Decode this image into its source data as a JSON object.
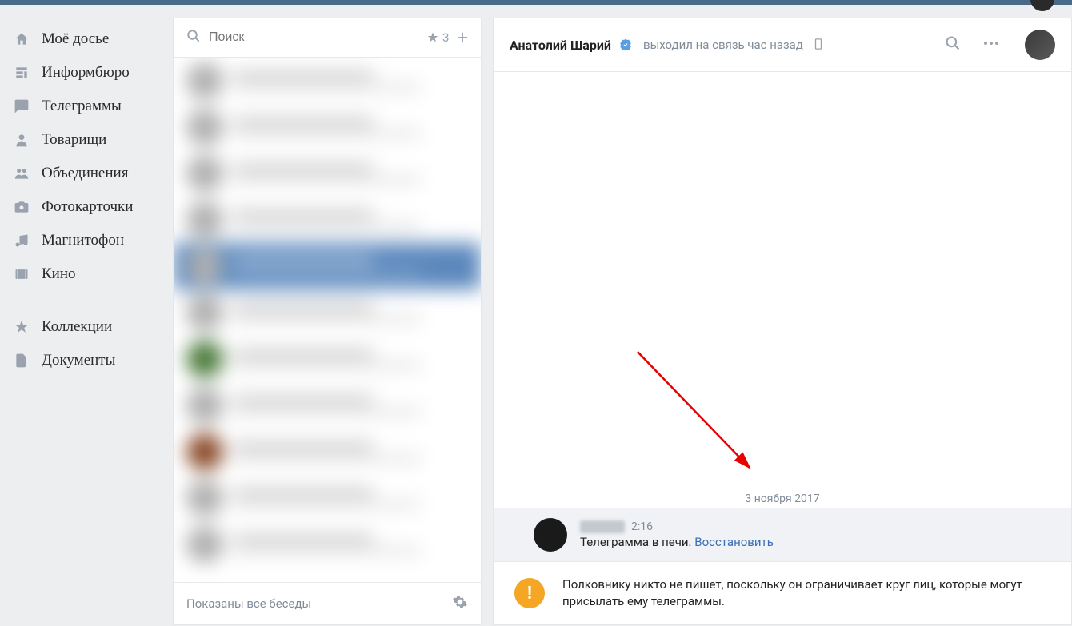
{
  "sidebar": {
    "items": [
      {
        "label": "Моё досье",
        "icon": "home"
      },
      {
        "label": "Информбюро",
        "icon": "news"
      },
      {
        "label": "Телеграммы",
        "icon": "messages"
      },
      {
        "label": "Товарищи",
        "icon": "friends"
      },
      {
        "label": "Объединения",
        "icon": "groups"
      },
      {
        "label": "Фотокарточки",
        "icon": "photos"
      },
      {
        "label": "Магнитофон",
        "icon": "music"
      },
      {
        "label": "Кино",
        "icon": "video"
      }
    ],
    "items2": [
      {
        "label": "Коллекции",
        "icon": "star"
      },
      {
        "label": "Документы",
        "icon": "docs"
      }
    ]
  },
  "dialogs": {
    "search_placeholder": "Поиск",
    "starred_count": "3",
    "footer_text": "Показаны все беседы"
  },
  "chat": {
    "name": "Анатолий Шарий",
    "status": "выходил на связь час назад",
    "date_divider": "3 ноября 2017",
    "message": {
      "time": "2:16",
      "text": "Телеграмма в печи. ",
      "restore": "Восстановить"
    },
    "notice": "Полковнику никто не пишет, поскольку он ограничивает круг лиц, которые могут присылать ему телеграммы."
  }
}
